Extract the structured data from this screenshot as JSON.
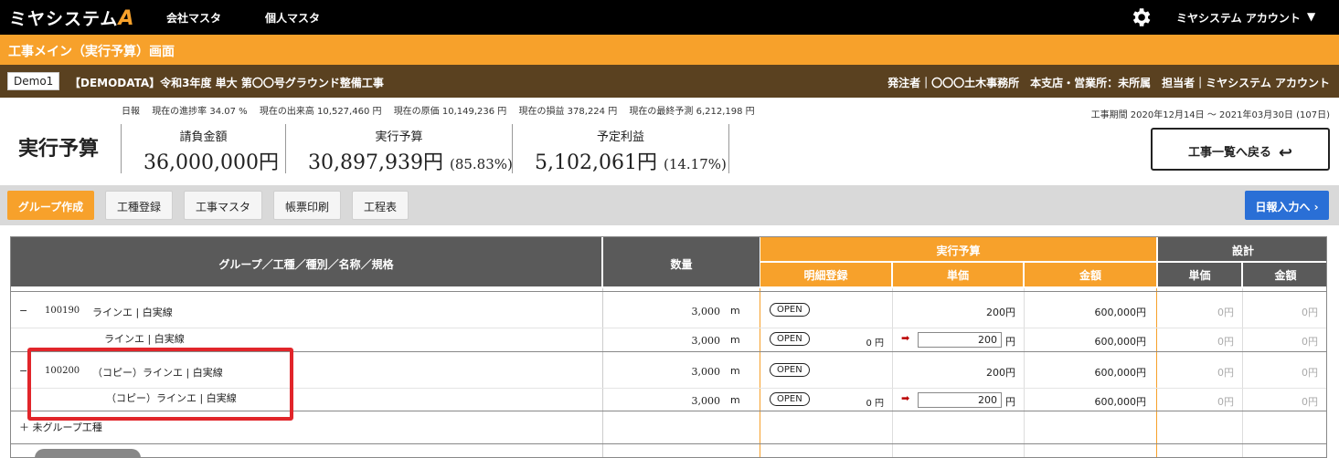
{
  "app": {
    "logo": "ミヤシステム",
    "logo_accent": "A",
    "nav": [
      "会社マスタ",
      "個人マスタ"
    ],
    "account": "ミヤシステム アカウント",
    "caret": "▼"
  },
  "screen_title": "工事メイン（実行予算）画面",
  "project": {
    "badge": "Demo1",
    "name": "【DEMODATA】令和3年度 単大 第〇〇号グラウンド整備工事",
    "meta": "発注者｜〇〇〇土木事務所　本支店・営業所：未所属　担当者｜ミヤシステム アカウント"
  },
  "stats": [
    "日報",
    "現在の進捗率 34.07 %",
    "現在の出来高 10,527,460 円",
    "現在の原価 10,149,236 円",
    "現在の損益 378,224 円",
    "現在の最終予測 6,212,198 円"
  ],
  "period": "工事期間 2020年12月14日 〜 2021年03月30日 (107日)",
  "page_heading": "実行予算",
  "metrics": [
    {
      "label": "請負金額",
      "value": "36,000,000円",
      "sub": ""
    },
    {
      "label": "実行予算",
      "value": "30,897,939円",
      "sub": "(85.83%)"
    },
    {
      "label": "予定利益",
      "value": "5,102,061円",
      "sub": "(14.17%)"
    }
  ],
  "back_button": "工事一覧へ戻る",
  "back_icon": "↩",
  "toolbar": {
    "buttons": [
      "グループ作成",
      "工種登録",
      "工事マスタ",
      "帳票印刷",
      "工程表"
    ],
    "daily": "日報入力へ ›"
  },
  "table": {
    "h_name": "グループ／工種／種別／名称／規格",
    "h_qty": "数量",
    "h_budget": "実行予算",
    "h_design": "設計",
    "h_detail": "明細登録",
    "h_unit": "単価",
    "h_amount": "金額",
    "h_d_unit": "単価",
    "h_d_amount": "金額",
    "rows": [
      {
        "toggle": "−",
        "code": "100190",
        "name": "ラインエ | 白実線",
        "qty": "3,000",
        "unit": "m",
        "open": "OPEN",
        "detail": "",
        "price": "200円",
        "amount": "600,000円",
        "d_price": "0円",
        "d_amount": "0円"
      },
      {
        "toggle": "",
        "code": "",
        "name": "ラインエ | 白実線",
        "qty": "3,000",
        "unit": "m",
        "open": "OPEN",
        "detail": "0 円",
        "arrow": "➡",
        "price_input": "200",
        "price_unit": "円",
        "amount": "600,000円",
        "d_price": "0円",
        "d_amount": "0円"
      },
      {
        "toggle": "−",
        "code": "100200",
        "name": "（コピー）ラインエ | 白実線",
        "qty": "3,000",
        "unit": "m",
        "open": "OPEN",
        "detail": "",
        "price": "200円",
        "amount": "600,000円",
        "d_price": "0円",
        "d_amount": "0円"
      },
      {
        "toggle": "",
        "code": "",
        "name": "（コピー）ラインエ | 白実線",
        "qty": "3,000",
        "unit": "m",
        "open": "OPEN",
        "detail": "0 円",
        "arrow": "➡",
        "price_input": "200",
        "price_unit": "円",
        "amount": "600,000円",
        "d_price": "0円",
        "d_amount": "0円"
      }
    ],
    "ungrouped": "＋ 未グループ工種"
  }
}
